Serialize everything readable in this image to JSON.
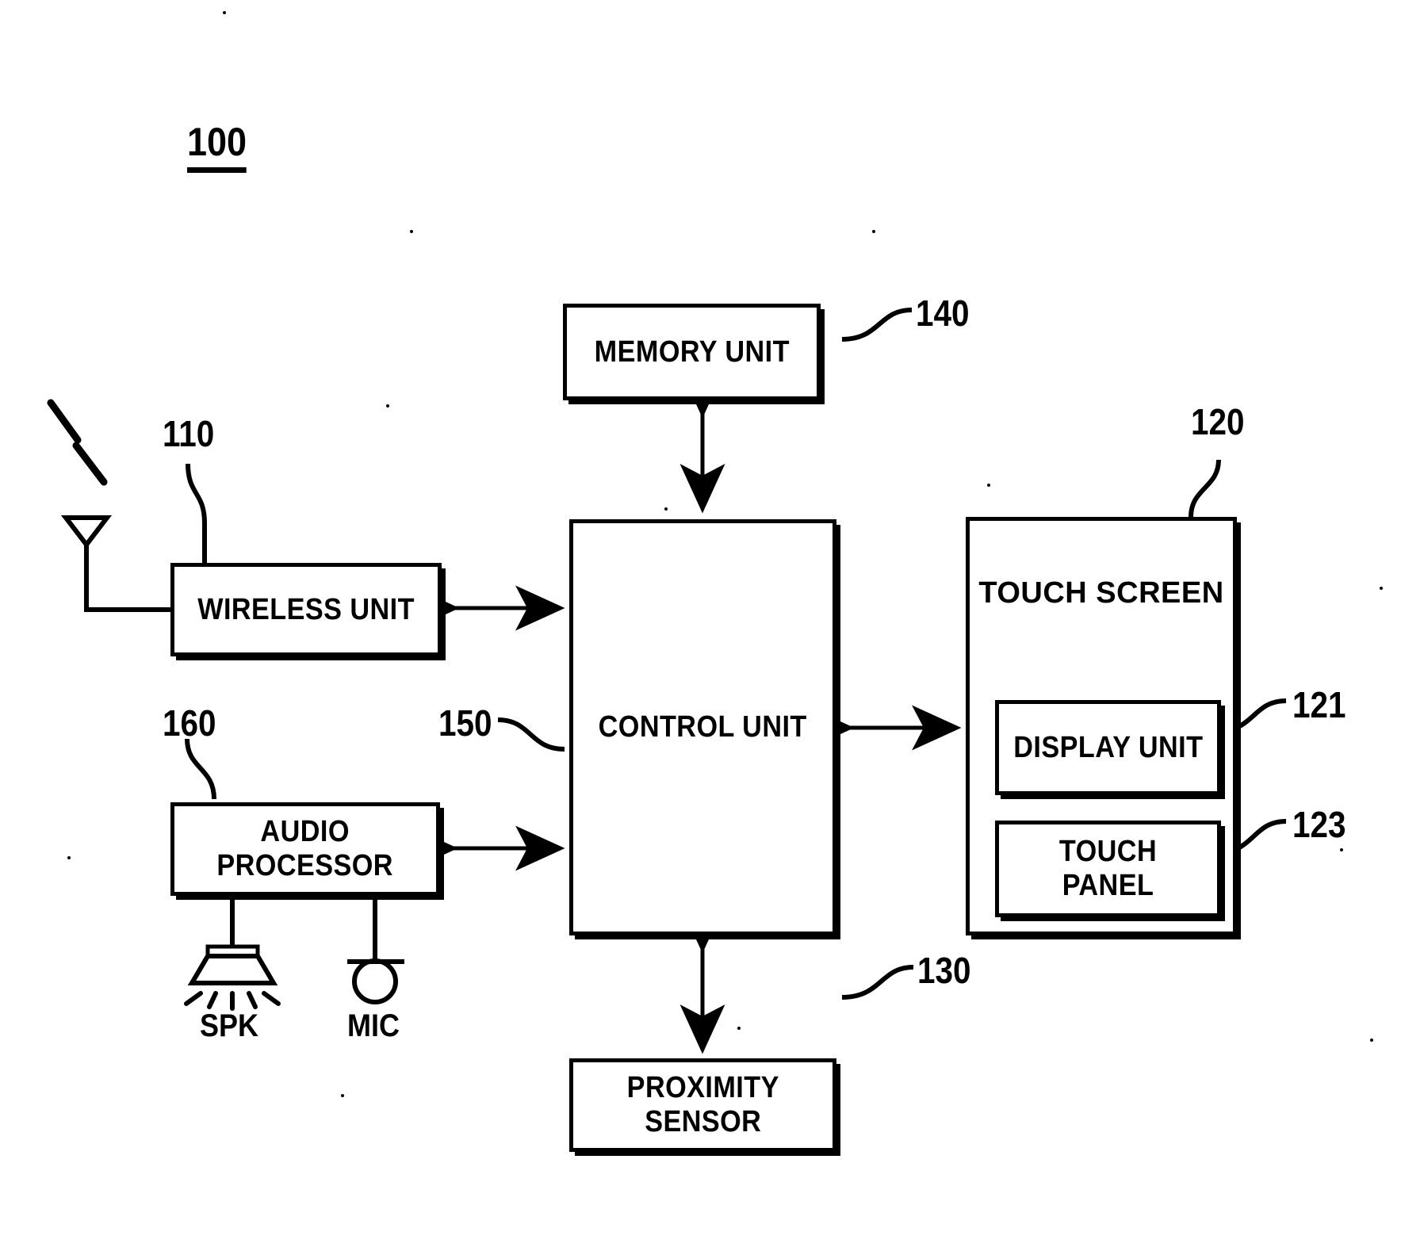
{
  "figure": {
    "number": "100",
    "title_hidden": ""
  },
  "blocks": {
    "memory": {
      "label": "MEMORY UNIT",
      "ref": "140"
    },
    "control": {
      "label": "CONTROL UNIT",
      "ref": "150"
    },
    "wireless": {
      "label": "WIRELESS UNIT",
      "ref": "110"
    },
    "audio": {
      "label": "AUDIO\nPROCESSOR",
      "ref": "160"
    },
    "proximity": {
      "label": "PROXIMITY\nSENSOR",
      "ref": "130"
    },
    "touchscreen": {
      "label": "TOUCH SCREEN",
      "ref": "120"
    },
    "display": {
      "label": "DISPLAY UNIT",
      "ref": "121"
    },
    "touchpanel": {
      "label": "TOUCH PANEL",
      "ref": "123"
    }
  },
  "peripherals": {
    "speaker": {
      "label": "SPK",
      "icon": "speaker-icon"
    },
    "microphone": {
      "label": "MIC",
      "icon": "microphone-icon"
    },
    "antenna": {
      "icon": "antenna-icon"
    }
  },
  "colors": {
    "line": "#000000",
    "background": "#ffffff"
  }
}
